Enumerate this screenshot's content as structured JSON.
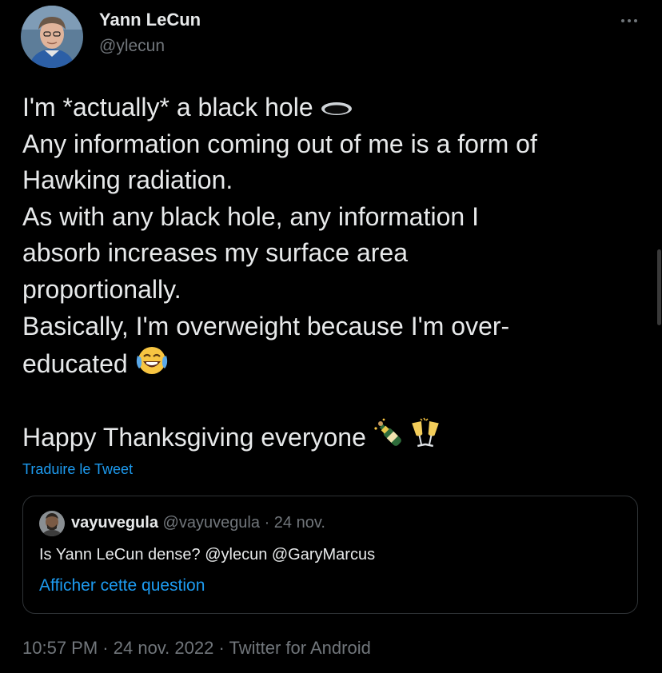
{
  "author": {
    "name": "Yann LeCun",
    "handle": "@ylecun"
  },
  "tweet": {
    "lines": [
      "I'm *actually* a black hole",
      "Any information coming out of me is a form of",
      "Hawking radiation.",
      "As with any black hole, any information I",
      "absorb increases my surface area",
      "proportionally.",
      "Basically, I'm overweight because I'm over-",
      "educated",
      "",
      "Happy Thanksgiving everyone"
    ],
    "emojis": {
      "line1": "hole-emoji",
      "line8": "face-with-tears-of-joy-emoji",
      "line10": [
        "bottle-with-popping-cork-emoji",
        "clinking-glasses-emoji"
      ]
    },
    "translate_label": "Traduire le Tweet",
    "timestamp": {
      "time": "10:57 PM",
      "separator": "·",
      "date": "24 nov. 2022",
      "client": "Twitter for Android"
    }
  },
  "quote": {
    "name": "vayuvegula",
    "handle": "@vayuvegula",
    "separator": "·",
    "date": "24 nov.",
    "text": "Is Yann LeCun dense? @ylecun @GaryMarcus",
    "link_label": "Afficher cette question"
  },
  "colors": {
    "background": "#000000",
    "text": "#e7e9ea",
    "secondary": "#71767b",
    "accent": "#1d9bf0",
    "border": "#2f3336"
  },
  "icons": {
    "more": "more-horizontal-icon"
  }
}
